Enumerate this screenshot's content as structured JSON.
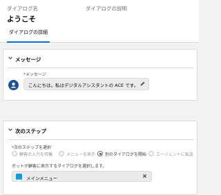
{
  "header": {
    "dialog_name_label": "ダイアログ名",
    "dialog_name_value": "ようこそ",
    "dialog_description_label": "ダイアログの説明",
    "tabs": [
      {
        "label": "ダイアログの詳細",
        "active": true
      }
    ]
  },
  "message_section": {
    "title": "メッセージ",
    "field_label": "メッセージ",
    "required_marker": "*",
    "value": "こんにちは。私はデジタルアシスタントの ACE です。"
  },
  "next_step_section": {
    "title": "次のステップ",
    "field_label": "次のステップを選択",
    "required_marker": "*",
    "options": [
      {
        "label": "顧客の入力を待機",
        "selected": false
      },
      {
        "label": "メニューを表示",
        "selected": false
      },
      {
        "label": "別のダイアログを開始",
        "selected": true
      },
      {
        "label": "エージェントに転送",
        "selected": false
      }
    ],
    "select_dialog_label": "ボットが顧客に表示するダイアログを選択します。",
    "selected_dialog": "メインメニュー"
  },
  "colors": {
    "accent": "#0070d2",
    "avatar": "#1b5297",
    "pill_icon": "#0d9dda",
    "required": "#c23934"
  },
  "icons": {
    "section_toggle": "chevron-down-icon",
    "avatar": "bot-avatar-icon",
    "edit": "pencil-icon",
    "dialog": "dialog-icon",
    "remove": "close-icon"
  }
}
